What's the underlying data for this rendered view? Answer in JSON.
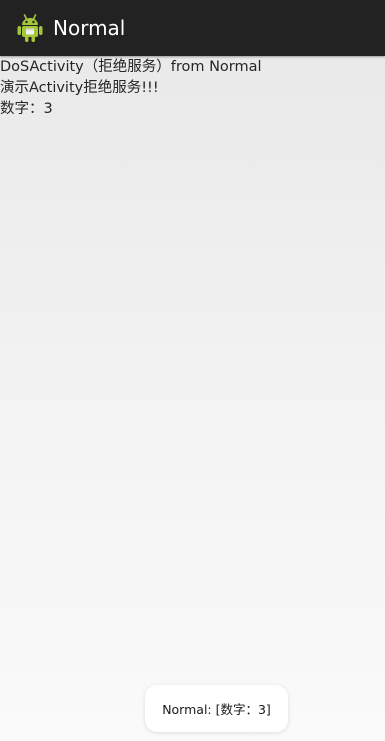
{
  "action_bar": {
    "icon": "android-robot-icon",
    "title": "Normal"
  },
  "content": {
    "lines": [
      "DoSActivity（拒绝服务）from Normal",
      "演示Activity拒绝服务!!!",
      "数字：3"
    ]
  },
  "toast": {
    "text": "Normal: [数字：3]"
  },
  "colors": {
    "action_bar_bg": "#222222",
    "android_green": "#A4C639",
    "title_text": "#ffffff",
    "body_text": "#262626"
  }
}
